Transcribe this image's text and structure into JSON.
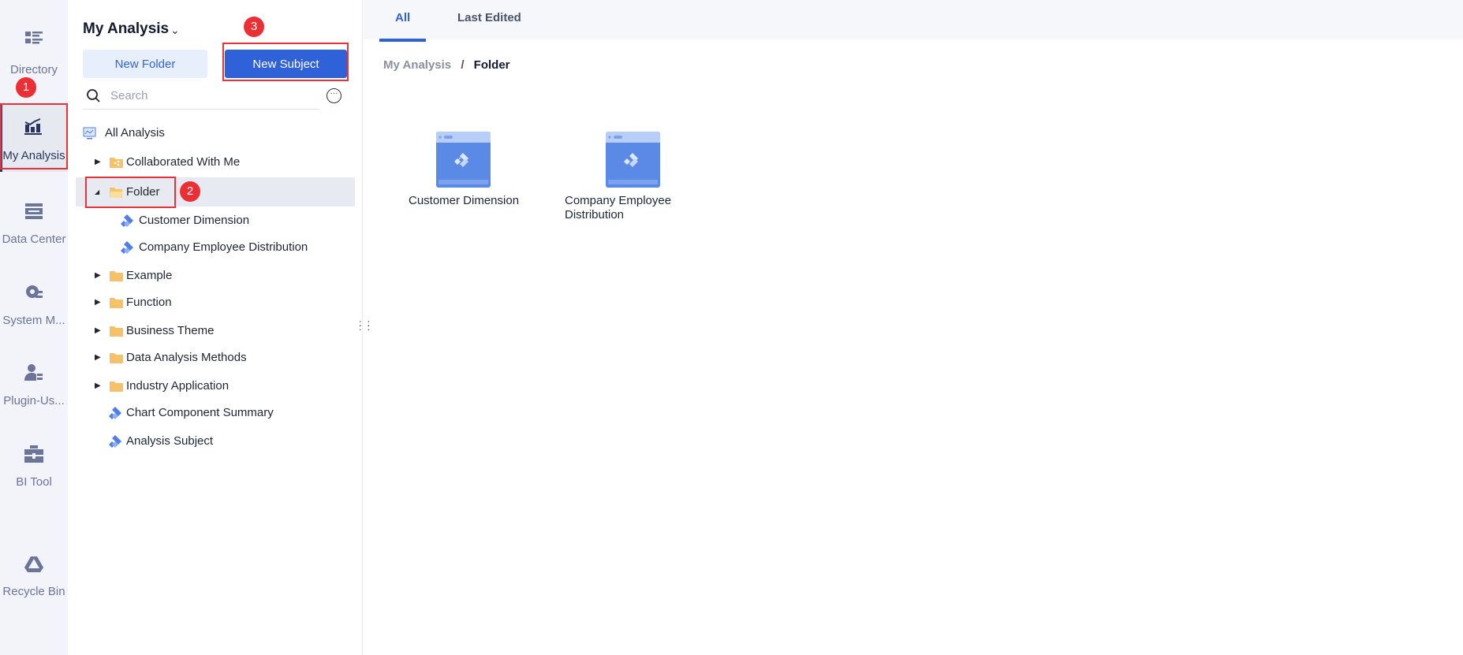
{
  "nav": {
    "items": [
      {
        "label": "Directory",
        "icon": "directory-icon"
      },
      {
        "label": "My Analysis",
        "icon": "analysis-chart-icon",
        "active": true
      },
      {
        "label": "Data Center",
        "icon": "data-center-icon"
      },
      {
        "label": "System M...",
        "icon": "system-gear-icon"
      },
      {
        "label": "Plugin-Us...",
        "icon": "plugin-user-icon"
      },
      {
        "label": "BI Tool",
        "icon": "toolbox-icon"
      },
      {
        "label": "Recycle Bin",
        "icon": "recycle-bin-icon"
      }
    ]
  },
  "panel": {
    "title": "My Analysis",
    "new_folder": "New Folder",
    "new_subject": "New Subject",
    "search_placeholder": "Search",
    "tree": [
      {
        "label": "All Analysis",
        "type": "root"
      },
      {
        "label": "Collaborated With Me",
        "type": "shared-folder"
      },
      {
        "label": "Folder",
        "type": "folder",
        "expanded": true,
        "selected": true
      },
      {
        "label": "Customer Dimension",
        "type": "subject"
      },
      {
        "label": "Company Employee Distribution",
        "type": "subject"
      },
      {
        "label": "Example",
        "type": "folder"
      },
      {
        "label": "Function",
        "type": "folder"
      },
      {
        "label": "Business Theme",
        "type": "folder"
      },
      {
        "label": "Data Analysis Methods",
        "type": "folder"
      },
      {
        "label": "Industry Application",
        "type": "folder"
      },
      {
        "label": "Chart Component Summary",
        "type": "subject"
      },
      {
        "label": "Analysis Subject",
        "type": "subject"
      }
    ]
  },
  "main": {
    "tabs": [
      {
        "label": "All",
        "active": true
      },
      {
        "label": "Last Edited"
      }
    ],
    "breadcrumb": {
      "parent": "My Analysis",
      "sep": "/",
      "current": "Folder"
    },
    "cards": [
      {
        "label": "Customer Dimension"
      },
      {
        "label": "Company Employee Distribution"
      }
    ]
  },
  "annotations": [
    "1",
    "2",
    "3"
  ],
  "colors": {
    "accent": "#2f62d9",
    "annotation": "#ea2f35",
    "folder": "#f5c26b"
  }
}
